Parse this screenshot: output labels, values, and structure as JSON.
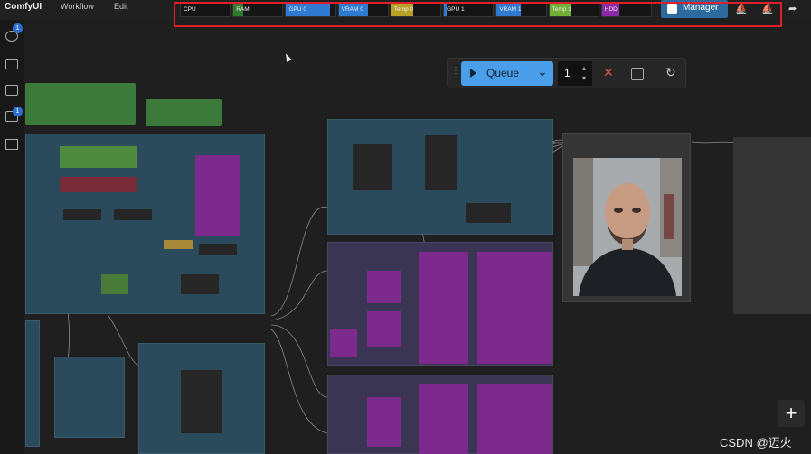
{
  "app": {
    "title": "ComfyUI"
  },
  "menu": {
    "items": [
      "Workflow",
      "Edit"
    ]
  },
  "monitor": {
    "cells": [
      {
        "label": "CPU",
        "fill_color": "",
        "level": 0
      },
      {
        "label": "RAM",
        "fill_color": "#2f7a2f",
        "level": 0.2
      },
      {
        "label": "GPU 0",
        "fill_color": "#2e7bd1",
        "level": 0.9
      },
      {
        "label": "VRAM 0",
        "fill_color": "#2e7bd1",
        "level": 0.6
      },
      {
        "label": "Temp 0",
        "fill_color": "#b9a128",
        "level": 0.45
      },
      {
        "label": "GPU 1",
        "fill_color": "#2e7bd1",
        "level": 0.05
      },
      {
        "label": "VRAM 1",
        "fill_color": "#2e7bd1",
        "level": 0.5
      },
      {
        "label": "Temp 1",
        "fill_color": "#6fb035",
        "level": 0.45
      },
      {
        "label": "HDD",
        "fill_color": "#8a2aa8",
        "level": 0.35
      }
    ]
  },
  "toolbar": {
    "manager_label": "Manager"
  },
  "sidebar": {
    "badge_queue": "1",
    "badge_models": "1"
  },
  "queue": {
    "label": "Queue",
    "count": "1"
  },
  "canvas": {
    "plus": "+"
  },
  "watermark": "CSDN @迈火",
  "colors": {
    "accent": "#4a9eea",
    "highlight": "#e01f2c",
    "node_group": "#2b4a5c",
    "purple": "#7c2a8c",
    "green": "#3b7a3a"
  }
}
